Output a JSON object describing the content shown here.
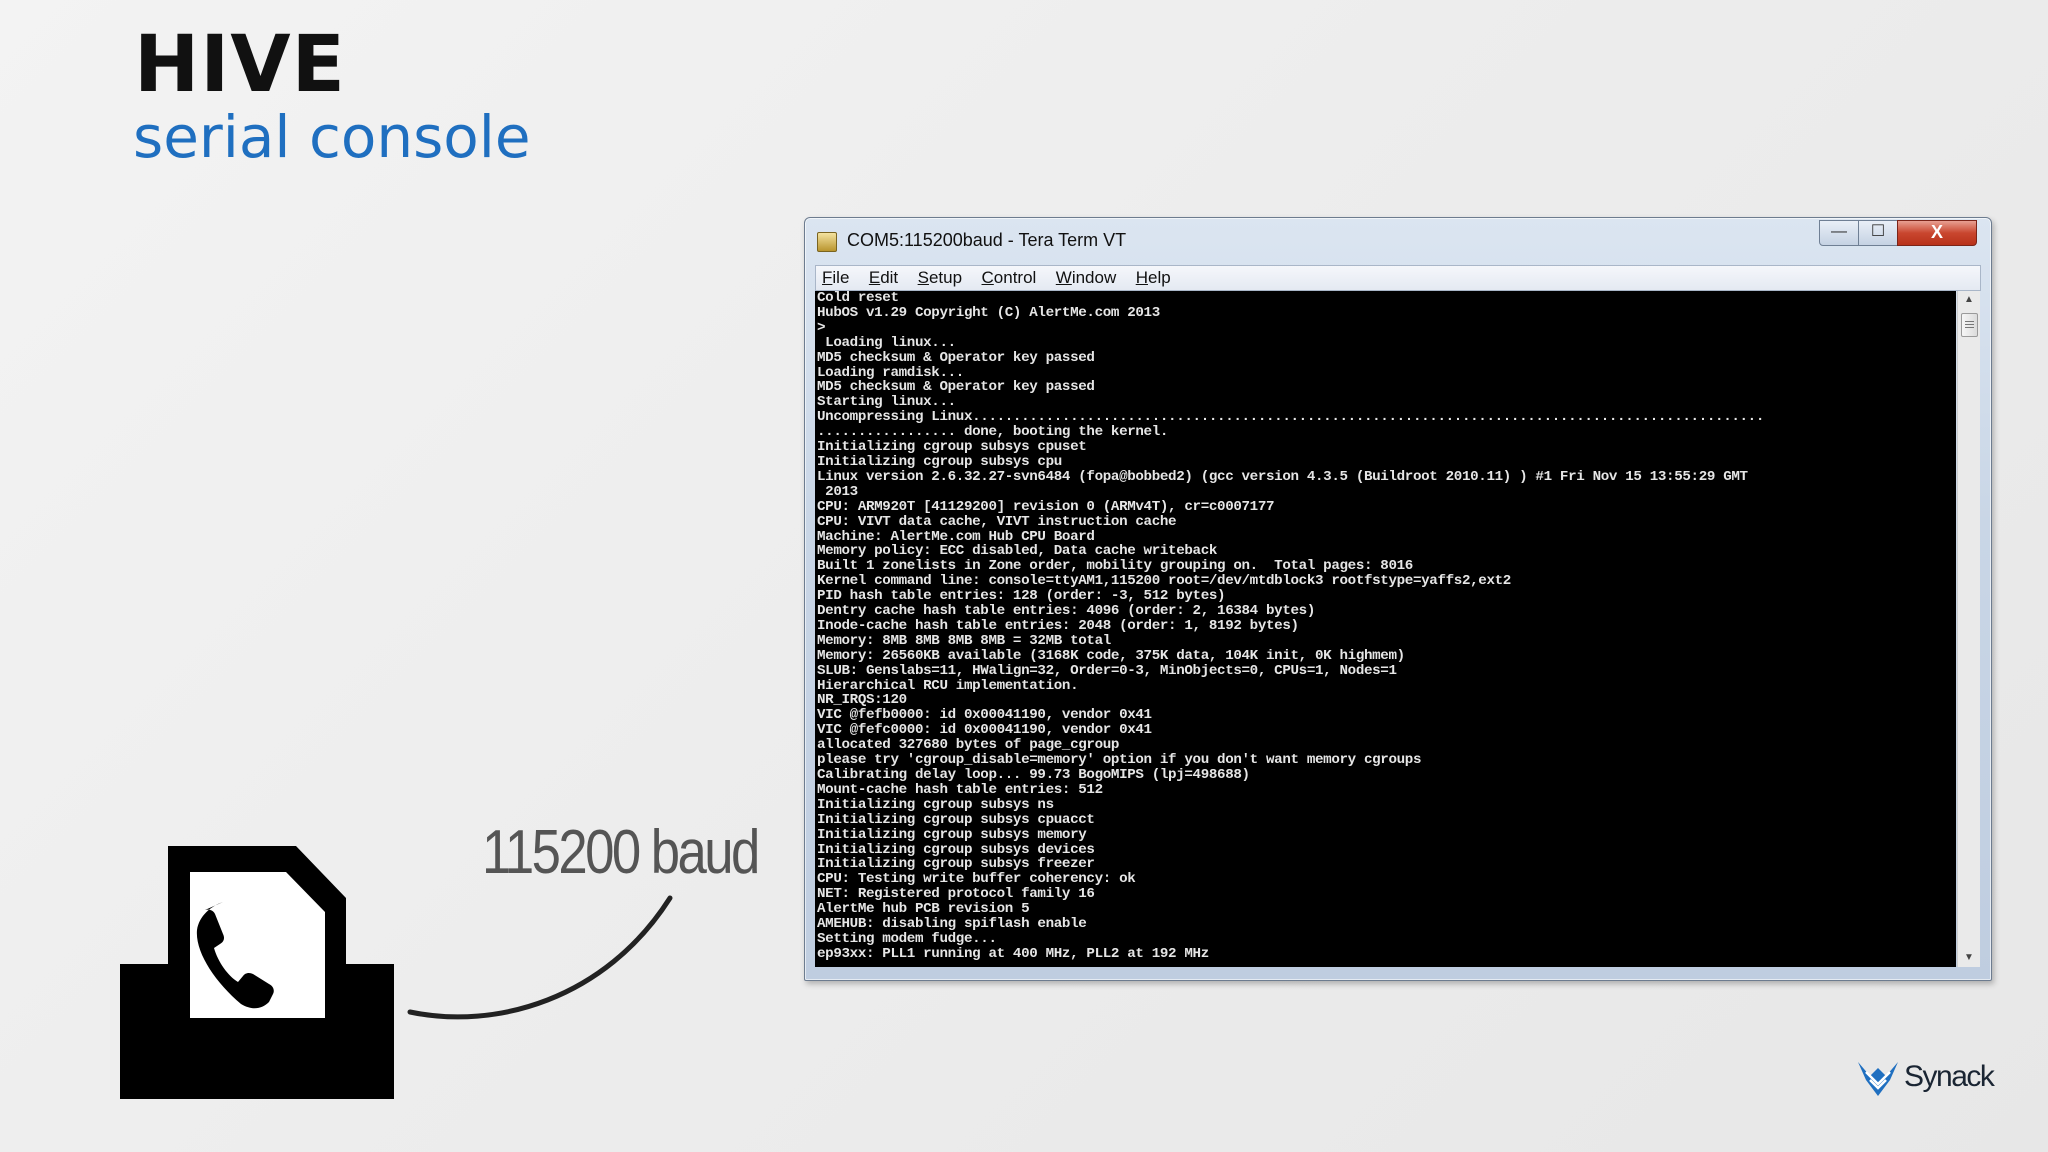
{
  "slide": {
    "title": "HIVE",
    "subtitle": "serial console",
    "baud_label": "115200 baud",
    "brand": "Synack"
  },
  "window": {
    "title": "COM5:115200baud - Tera Term VT",
    "controls": {
      "minimize": "—",
      "maximize": "☐",
      "close": "X"
    },
    "menu": [
      {
        "u": "F",
        "rest": "ile"
      },
      {
        "u": "E",
        "rest": "dit"
      },
      {
        "u": "S",
        "rest": "etup"
      },
      {
        "u": "C",
        "rest": "ontrol"
      },
      {
        "u": "W",
        "rest": "indow"
      },
      {
        "u": "H",
        "rest": "elp"
      }
    ],
    "terminal_lines": [
      "Cold reset",
      "HubOS v1.29 Copyright (C) AlertMe.com 2013",
      ">",
      " Loading linux...",
      "MD5 checksum & Operator key passed",
      "Loading ramdisk...",
      "MD5 checksum & Operator key passed",
      "Starting linux...",
      "Uncompressing Linux.................................................................................................",
      "................. done, booting the kernel.",
      "Initializing cgroup subsys cpuset",
      "Initializing cgroup subsys cpu",
      "Linux version 2.6.32.27-svn6484 (fopa@bobbed2) (gcc version 4.3.5 (Buildroot 2010.11) ) #1 Fri Nov 15 13:55:29 GMT",
      " 2013",
      "CPU: ARM920T [41129200] revision 0 (ARMv4T), cr=c0007177",
      "CPU: VIVT data cache, VIVT instruction cache",
      "Machine: AlertMe.com Hub CPU Board",
      "Memory policy: ECC disabled, Data cache writeback",
      "Built 1 zonelists in Zone order, mobility grouping on.  Total pages: 8016",
      "Kernel command line: console=ttyAM1,115200 root=/dev/mtdblock3 rootfstype=yaffs2,ext2",
      "PID hash table entries: 128 (order: -3, 512 bytes)",
      "Dentry cache hash table entries: 4096 (order: 2, 16384 bytes)",
      "Inode-cache hash table entries: 2048 (order: 1, 8192 bytes)",
      "Memory: 8MB 8MB 8MB 8MB = 32MB total",
      "Memory: 26560KB available (3168K code, 375K data, 104K init, 0K highmem)",
      "SLUB: Genslabs=11, HWalign=32, Order=0-3, MinObjects=0, CPUs=1, Nodes=1",
      "Hierarchical RCU implementation.",
      "NR_IRQS:120",
      "VIC @fefb0000: id 0x00041190, vendor 0x41",
      "VIC @fefc0000: id 0x00041190, vendor 0x41",
      "allocated 327680 bytes of page_cgroup",
      "please try 'cgroup_disable=memory' option if you don't want memory cgroups",
      "Calibrating delay loop... 99.73 BogoMIPS (lpj=498688)",
      "Mount-cache hash table entries: 512",
      "Initializing cgroup subsys ns",
      "Initializing cgroup subsys cpuacct",
      "Initializing cgroup subsys memory",
      "Initializing cgroup subsys devices",
      "Initializing cgroup subsys freezer",
      "CPU: Testing write buffer coherency: ok",
      "NET: Registered protocol family 16",
      "AlertMe hub PCB revision 5",
      "AMEHUB: disabling spiflash enable",
      "Setting modem fudge...",
      "ep93xx: PLL1 running at 400 MHz, PLL2 at 192 MHz"
    ]
  },
  "icons": {
    "device": "phone-document-icon",
    "app": "tera-term-icon",
    "logo": "synack-logo-icon"
  }
}
